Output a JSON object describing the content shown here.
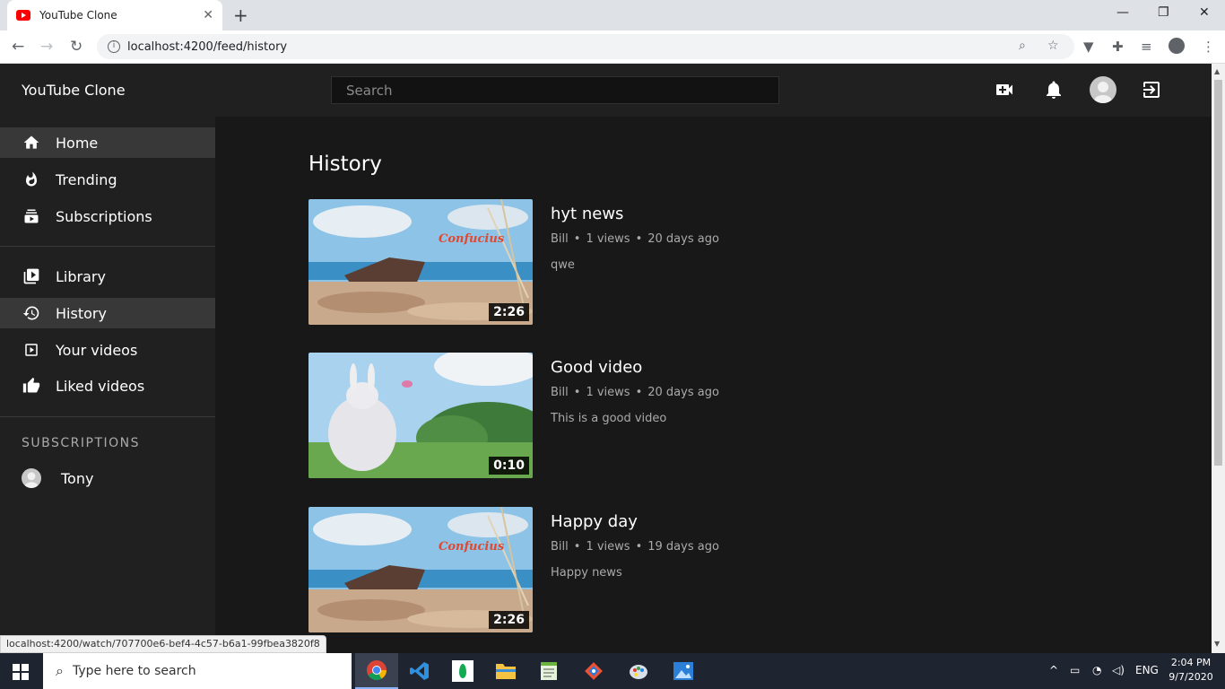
{
  "browser": {
    "tab_title": "YouTube Clone",
    "url": "localhost:4200/feed/history",
    "status_url": "localhost:4200/watch/707700e6-bef4-4c57-b6a1-99fbea3820f8"
  },
  "header": {
    "app_title": "YouTube Clone",
    "search_placeholder": "Search"
  },
  "sidebar": {
    "items": [
      {
        "label": "Home",
        "icon": "home-icon"
      },
      {
        "label": "Trending",
        "icon": "fire-icon"
      },
      {
        "label": "Subscriptions",
        "icon": "subscriptions-icon"
      },
      {
        "label": "Library",
        "icon": "library-icon"
      },
      {
        "label": "History",
        "icon": "history-icon"
      },
      {
        "label": "Your videos",
        "icon": "your-videos-icon"
      },
      {
        "label": "Liked videos",
        "icon": "thumbs-up-icon"
      }
    ],
    "subscriptions_heading": "SUBSCRIPTIONS",
    "subscriptions": [
      {
        "name": "Tony"
      }
    ]
  },
  "main": {
    "page_title": "History",
    "videos": [
      {
        "title": "hyt news",
        "channel": "Bill",
        "views": "1 views",
        "age": "20 days ago",
        "description": "qwe",
        "duration": "2:26"
      },
      {
        "title": "Good video",
        "channel": "Bill",
        "views": "1 views",
        "age": "20 days ago",
        "description": "This is a good video",
        "duration": "0:10"
      },
      {
        "title": "Happy day",
        "channel": "Bill",
        "views": "1 views",
        "age": "19 days ago",
        "description": "Happy news",
        "duration": "2:26"
      }
    ]
  },
  "taskbar": {
    "search_placeholder": "Type here to search",
    "language": "ENG",
    "time": "2:04 PM",
    "date": "9/7/2020"
  },
  "colors": {
    "header_bg": "#202020",
    "content_bg": "#181818",
    "active_item_bg": "#383838",
    "youtube_red": "#ff0000"
  }
}
